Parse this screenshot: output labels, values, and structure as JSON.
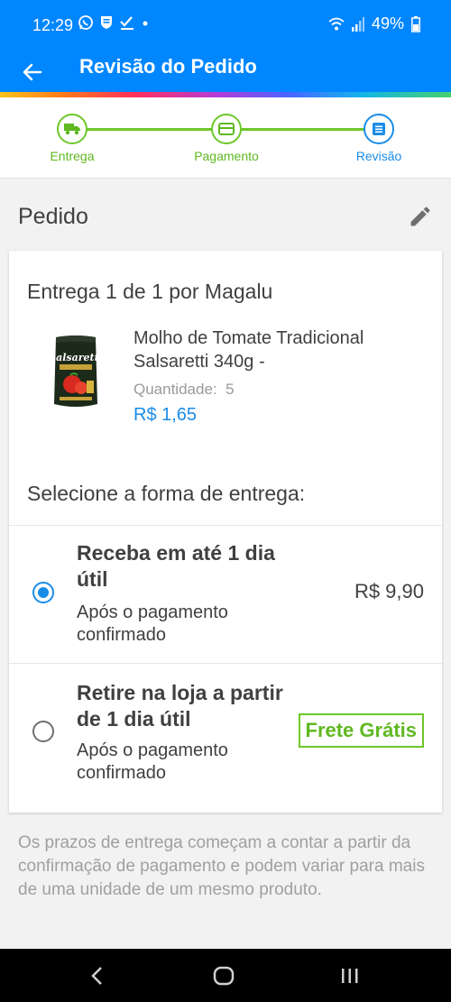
{
  "status_bar": {
    "time": "12:29",
    "battery": "49%"
  },
  "header": {
    "title": "Revisão do Pedido"
  },
  "stepper": {
    "steps": [
      {
        "label": "Entrega",
        "state": "done",
        "icon": "truck-icon"
      },
      {
        "label": "Pagamento",
        "state": "done",
        "icon": "card-icon"
      },
      {
        "label": "Revisão",
        "state": "active",
        "icon": "list-icon"
      }
    ]
  },
  "order": {
    "section_title": "Pedido",
    "delivery_title": "Entrega 1 de 1 por Magalu",
    "product": {
      "name": "Molho de Tomate Tradicional Salsaretti 340g -",
      "qty_label": "Quantidade:",
      "qty_value": "5",
      "price": "R$ 1,65",
      "brand_on_image": "Salsaretti"
    },
    "select_title": "Selecione a forma de entrega:",
    "options": [
      {
        "title": "Receba em até 1 dia útil",
        "subtitle": "Após o pagamento confirmado",
        "price": "R$ 9,90",
        "selected": true
      },
      {
        "title": "Retire na loja a partir de 1 dia útil",
        "subtitle": "Após o pagamento confirmado",
        "badge": "Frete Grátis",
        "selected": false
      }
    ]
  },
  "footer_note": "Os prazos de entrega começam a contar a partir da confirmação de pagamento e podem variar para mais de uma unidade de um mesmo produto.",
  "colors": {
    "primary": "#0086ff",
    "success": "#6ec72a",
    "link": "#1a8ce8"
  }
}
